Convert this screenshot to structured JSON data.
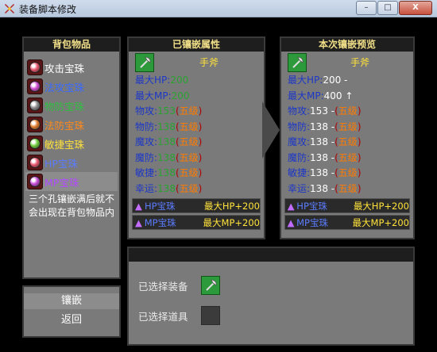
{
  "window": {
    "title": "装备脚本修改",
    "min_label": "–",
    "max_label": "□",
    "close_label": "X"
  },
  "backpack": {
    "header": "背包物品",
    "items": [
      {
        "label": "攻击宝珠",
        "text_color": "#ffffff",
        "gem_color": "#e8546a"
      },
      {
        "label": "法攻宝珠",
        "text_color": "#3a6bff",
        "gem_color": "#d04ad0"
      },
      {
        "label": "物防宝珠",
        "text_color": "#2fbf3f",
        "gem_color": "#8a8a8a"
      },
      {
        "label": "法防宝珠",
        "text_color": "#ff8a1a",
        "gem_color": "#e07a2a"
      },
      {
        "label": "敏捷宝珠",
        "text_color": "#ffe23a",
        "gem_color": "#6fcc3a"
      },
      {
        "label": "HP宝珠",
        "text_color": "#5b7cff",
        "gem_color": "#e8546a"
      },
      {
        "label": "MP宝珠",
        "text_color": "#b14aff",
        "gem_color": "#c84ad8"
      }
    ],
    "note": "三个孔镶嵌满后就不会出现在背包物品内"
  },
  "current": {
    "header": "已镶嵌属性",
    "weapon_name": "手斧",
    "weapon_icon": "axe-icon",
    "stats": [
      {
        "label": "最大HP:",
        "value": "200",
        "tag": ""
      },
      {
        "label": "最大MP:",
        "value": "200",
        "tag": ""
      },
      {
        "label": "物攻:",
        "value": "153",
        "tag": "五级"
      },
      {
        "label": "物防:",
        "value": "138",
        "tag": "五级"
      },
      {
        "label": "魔攻:",
        "value": "138",
        "tag": "五级"
      },
      {
        "label": "魔防:",
        "value": "138",
        "tag": "五级"
      },
      {
        "label": "敏捷:",
        "value": "138",
        "tag": "五级"
      },
      {
        "label": "幸运:",
        "value": "138",
        "tag": "五级"
      }
    ],
    "sockets": [
      {
        "name": "HP宝珠",
        "bonus": "最大HP+200"
      },
      {
        "name": "MP宝珠",
        "bonus": "最大MP+200"
      }
    ]
  },
  "preview": {
    "header": "本次镶嵌预览",
    "weapon_name": "手斧",
    "weapon_icon": "axe-icon",
    "stats": [
      {
        "label": "最大HP:",
        "value": "200 -",
        "tag": ""
      },
      {
        "label": "最大MP:",
        "value": "400 ↑",
        "tag": ""
      },
      {
        "label": "物攻:",
        "value": "153 -",
        "tag": "五级"
      },
      {
        "label": "物防:",
        "value": "138 -",
        "tag": "五级"
      },
      {
        "label": "魔攻:",
        "value": "138 -",
        "tag": "五级"
      },
      {
        "label": "魔防:",
        "value": "138 -",
        "tag": "五级"
      },
      {
        "label": "敏捷:",
        "value": "138 -",
        "tag": "五级"
      },
      {
        "label": "幸运:",
        "value": "138 -",
        "tag": "五级"
      }
    ],
    "sockets": [
      {
        "name": "HP宝珠",
        "bonus": "最大HP+200"
      },
      {
        "name": "MP宝珠",
        "bonus": "最大MP+200"
      }
    ]
  },
  "actions": {
    "embed_label": "镶嵌",
    "back_label": "返回"
  },
  "selection": {
    "equipment_label": "已选择装备",
    "item_label": "已选择道具",
    "equipment_icon": "axe-icon"
  },
  "colors": {
    "panel": "#7a7a7a",
    "header_text": "#f2e089",
    "label_blue": "#1c37c8",
    "value_green": "#29a330",
    "tag_orange": "#ff7b00"
  }
}
